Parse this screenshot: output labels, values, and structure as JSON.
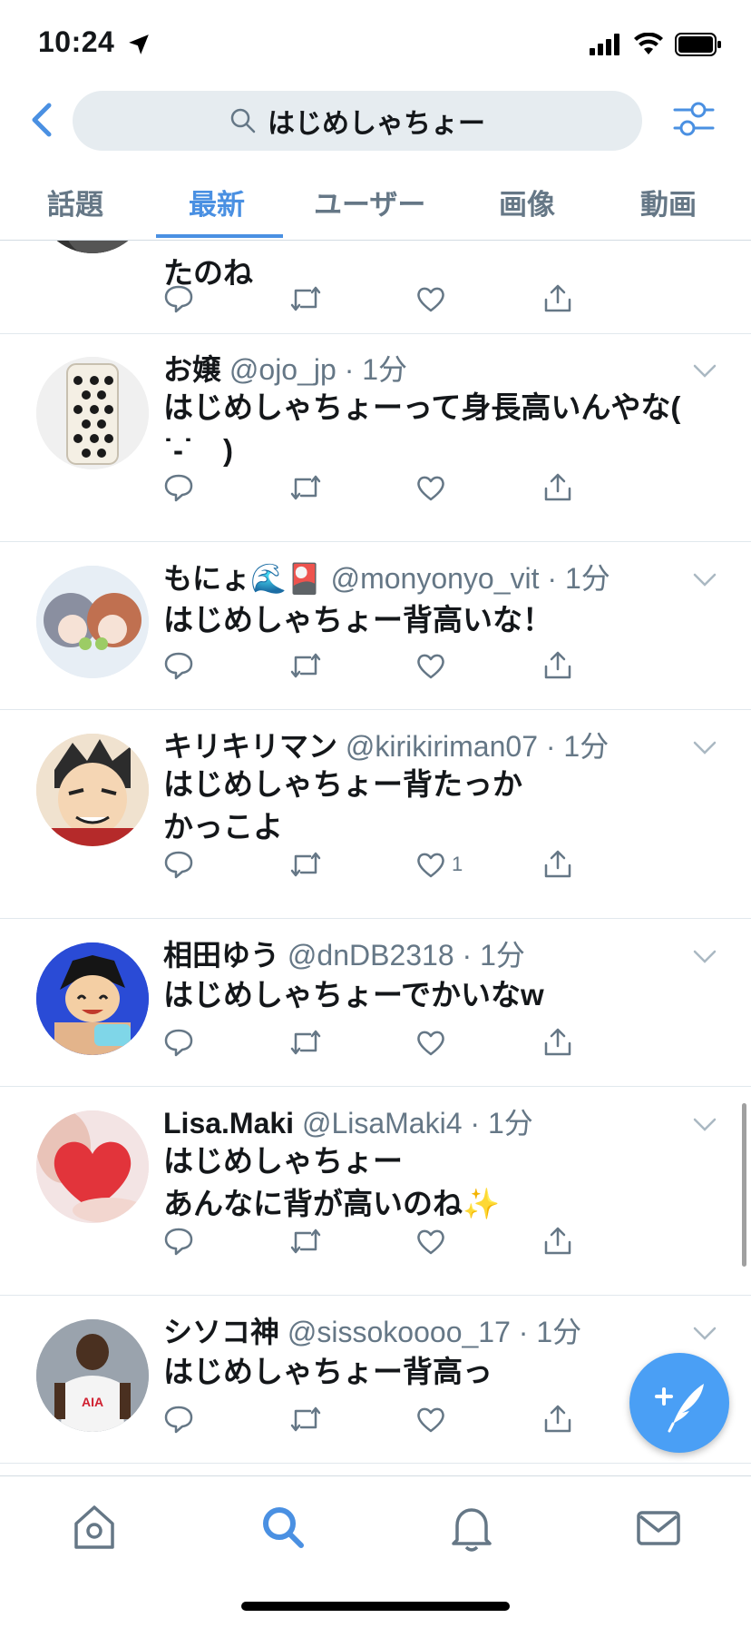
{
  "status_bar": {
    "time": "10:24"
  },
  "search": {
    "query": "はじめしゃちょー"
  },
  "tabs": [
    {
      "label": "話題"
    },
    {
      "label": "最新"
    },
    {
      "label": "ユーザー"
    },
    {
      "label": "画像"
    },
    {
      "label": "動画"
    }
  ],
  "tweets": [
    {
      "body": "たのね",
      "likes": ""
    },
    {
      "name": "お嬢",
      "handle": "@ojo_jp",
      "time": "1分",
      "body": "はじめしゃちょーって身長高いんやな(\n ˙-˙　)",
      "likes": ""
    },
    {
      "name": "もにょ🌊🎴",
      "handle": "@monyonyo_vit",
      "time": "1分",
      "body": "はじめしゃちょー背高いな！",
      "likes": ""
    },
    {
      "name": "キリキリマン",
      "handle": "@kirikiriman07",
      "time": "1分",
      "body": "はじめしゃちょー背たっか\nかっこよ",
      "likes": "1"
    },
    {
      "name": "相田ゆう",
      "handle": "@dnDB2318",
      "time": "1分",
      "body": "はじめしゃちょーでかいなw",
      "likes": ""
    },
    {
      "name": "Lisa.Maki",
      "handle": "@LisaMaki4",
      "time": "1分",
      "body": "はじめしゃちょー\nあんなに背が高いのね✨",
      "likes": ""
    },
    {
      "name": "シソコ神",
      "handle": "@sissokoooo_17",
      "time": "1分",
      "body": "はじめしゃちょー背高っ",
      "likes": ""
    }
  ],
  "colors": {
    "accent": "#4a90e2",
    "text": "#14171a",
    "muted": "#657786",
    "search_bg": "#e6ecf0",
    "fab": "#4a9ff5"
  },
  "icons": {
    "nav": [
      "home-icon",
      "search-icon",
      "bell-icon",
      "mail-icon"
    ],
    "actions": [
      "reply-icon",
      "retweet-icon",
      "heart-icon",
      "share-icon"
    ]
  }
}
